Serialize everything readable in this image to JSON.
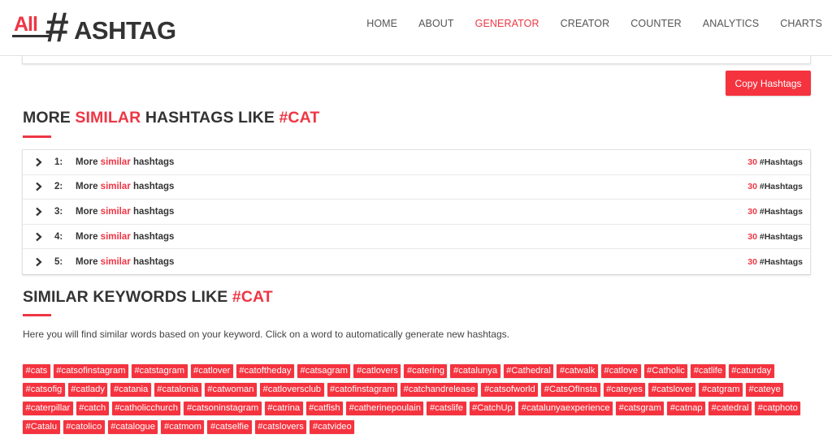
{
  "brand": {
    "logo_prefix": "All",
    "logo_hash": "#",
    "logo_suffix": "ASHTAG",
    "accent_color": "#ee3644"
  },
  "nav": {
    "items": [
      {
        "label": "HOME",
        "active": false
      },
      {
        "label": "ABOUT",
        "active": false
      },
      {
        "label": "GENERATOR",
        "active": true
      },
      {
        "label": "CREATOR",
        "active": false
      },
      {
        "label": "COUNTER",
        "active": false
      },
      {
        "label": "ANALYTICS",
        "active": false
      },
      {
        "label": "CHARTS",
        "active": false
      }
    ]
  },
  "copy_button": {
    "label": "Copy Hashtags"
  },
  "more_similar": {
    "title_part1": "MORE ",
    "title_part2": "SIMILAR",
    "title_part3": " HASHTAGS LIKE ",
    "title_keyword": "#CAT",
    "rows": [
      {
        "num": "1:",
        "pre": "More ",
        "highlight": "similar",
        "post": " hashtags",
        "count": "30",
        "count_label": " #Hashtags"
      },
      {
        "num": "2:",
        "pre": "More ",
        "highlight": "similar",
        "post": " hashtags",
        "count": "30",
        "count_label": " #Hashtags"
      },
      {
        "num": "3:",
        "pre": "More ",
        "highlight": "similar",
        "post": " hashtags",
        "count": "30",
        "count_label": " #Hashtags"
      },
      {
        "num": "4:",
        "pre": "More ",
        "highlight": "similar",
        "post": " hashtags",
        "count": "30",
        "count_label": " #Hashtags"
      },
      {
        "num": "5:",
        "pre": "More ",
        "highlight": "similar",
        "post": " hashtags",
        "count": "30",
        "count_label": " #Hashtags"
      }
    ]
  },
  "similar_keywords": {
    "title_part1": "SIMILAR KEYWORDS LIKE ",
    "title_keyword": "#CAT",
    "description": "Here you will find similar words based on your keyword. Click on a word to automatically generate new hashtags.",
    "tags": [
      "#cats",
      "#catsofinstagram",
      "#catstagram",
      "#catlover",
      "#catoftheday",
      "#catsagram",
      "#catlovers",
      "#catering",
      "#catalunya",
      "#Cathedral",
      "#catwalk",
      "#catlove",
      "#Catholic",
      "#catlife",
      "#caturday",
      "#catsofig",
      "#catlady",
      "#catania",
      "#catalonia",
      "#catwoman",
      "#catloversclub",
      "#catofinstagram",
      "#catchandrelease",
      "#catsofworld",
      "#CatsOfInsta",
      "#cateyes",
      "#catslover",
      "#catgram",
      "#cateye",
      "#caterpillar",
      "#catch",
      "#catholicchurch",
      "#catsoninstagram",
      "#catrina",
      "#catfish",
      "#catherinepoulain",
      "#catslife",
      "#CatchUp",
      "#catalunyaexperience",
      "#catsgram",
      "#catnap",
      "#catedral",
      "#catphoto",
      "#Catalu",
      "#catolico",
      "#catalogue",
      "#catmom",
      "#catselfie",
      "#catslovers",
      "#catvideo"
    ]
  }
}
